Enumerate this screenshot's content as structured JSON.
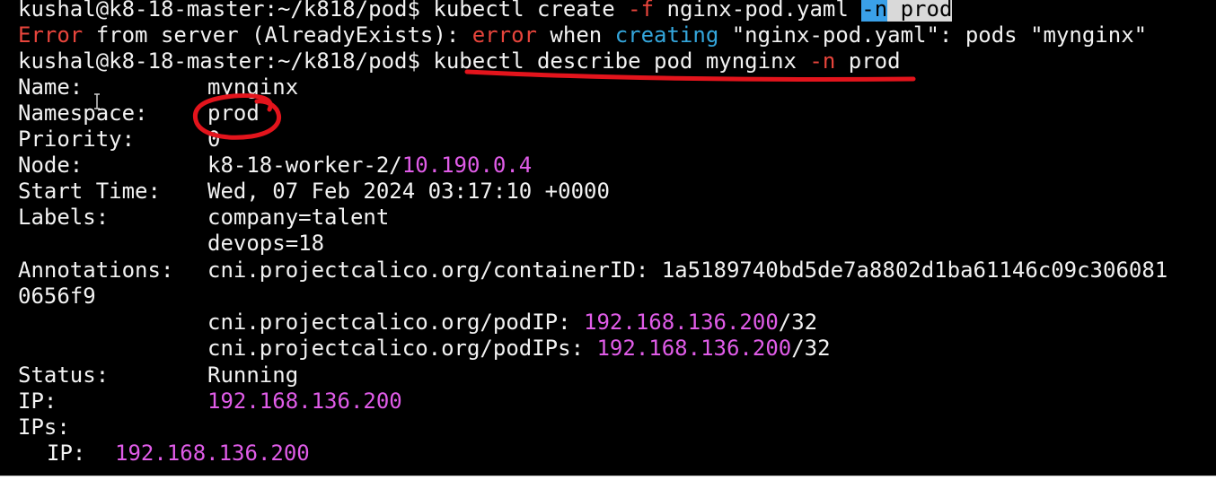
{
  "terminal": {
    "prompt": "kushal@k8-18-master:~/k818/pod$",
    "lines": {
      "l1": {
        "cmd": "kubectl create",
        "flag_f": "-f",
        "file": "nginx-pod.yaml",
        "flag_n": "-n",
        "ns": "prod"
      },
      "l2": {
        "err1": "Error",
        "mid1": " from server (AlreadyExists): ",
        "err2": "error",
        "mid2": " when ",
        "creating": "creating",
        "rest": " \"nginx-pod.yaml\": pods \"mynginx\""
      },
      "l3": {
        "cmd": "kubectl describe pod mynginx",
        "flag_n": "-n",
        "ns": "prod"
      }
    },
    "describe": {
      "name_key": "Name:",
      "name_val": "mynginx",
      "namespace_key": "Namespace:",
      "namespace_val": "prod",
      "priority_key": "Priority:",
      "priority_val": "0",
      "node_key": "Node:",
      "node_name": "k8-18-worker-2/",
      "node_ip": "10.190.0.4",
      "start_key": "Start Time:",
      "start_val": "Wed, 07 Feb 2024 03:17:10 +0000",
      "labels_key": "Labels:",
      "label_1": "company=talent",
      "label_2": "devops=18",
      "annotations_key": "Annotations:",
      "ann_container_key": "cni.projectcalico.org/containerID:",
      "ann_container_val_1": "1a5189740bd5de7a8802d1ba61146c09c306081",
      "ann_container_val_2": "0656f9",
      "ann_podip_key": "cni.projectcalico.org/podIP:",
      "ann_podip_ip": "192.168.136.200",
      "ann_podip_mask": "/32",
      "ann_podips_key": "cni.projectcalico.org/podIPs:",
      "ann_podips_ip": "192.168.136.200",
      "ann_podips_mask": "/32",
      "status_key": "Status:",
      "status_val": "Running",
      "ip_key": "IP:",
      "ip_val": "192.168.136.200",
      "ips_key": "IPs:",
      "ips_ip_key": "IP:",
      "ips_ip_val": "192.168.136.200"
    }
  },
  "colors": {
    "background": "#000000",
    "foreground": "#f2f2f2",
    "error_red": "#e8453c",
    "keyword_cyan": "#34a6dc",
    "ip_magenta": "#e05ce8",
    "selection_blue": "#3aa0e8",
    "annotation_marker": "#e3141c"
  }
}
